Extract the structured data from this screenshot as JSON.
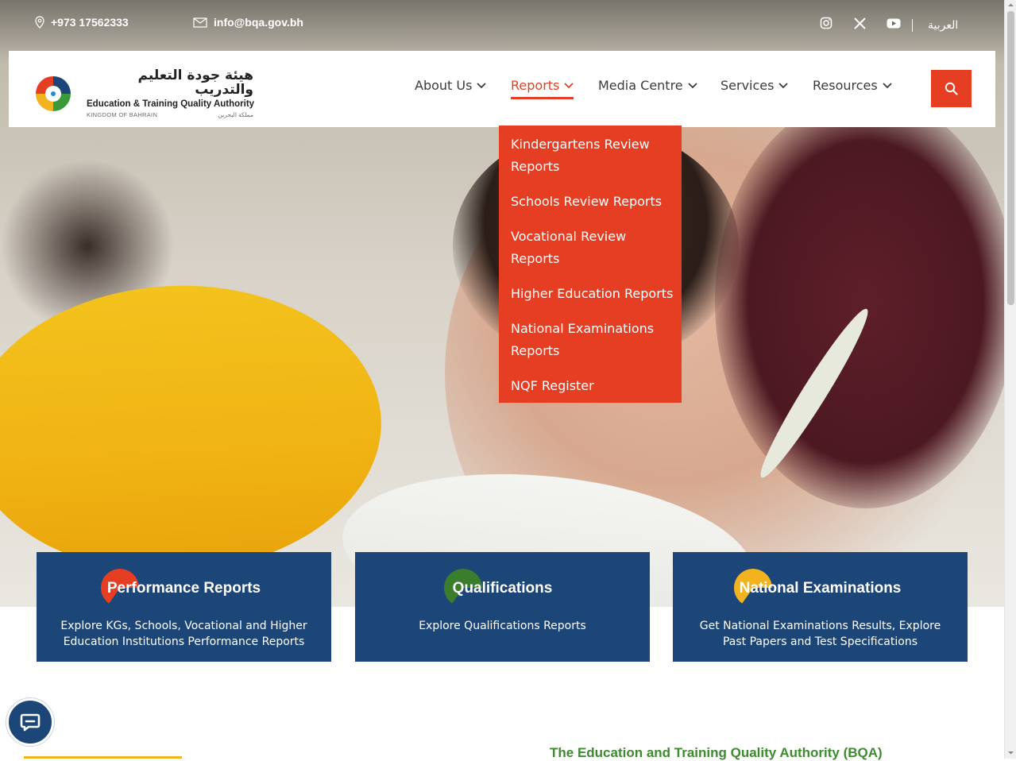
{
  "topbar": {
    "phone": "+973 17562333",
    "email": "info@bqa.gov.bh",
    "social": [
      "instagram-icon",
      "x-icon",
      "youtube-icon"
    ],
    "language": "العربية"
  },
  "logo": {
    "arabic": "هيئة جودة التعليم والتدريب",
    "english": "Education & Training Quality Authority",
    "sub_en": "KINGDOM OF BAHRAIN",
    "sub_ar": "مملكة البحرين"
  },
  "nav": {
    "items": [
      {
        "label": "About Us"
      },
      {
        "label": "Reports"
      },
      {
        "label": "Media Centre"
      },
      {
        "label": "Services"
      },
      {
        "label": "Resources"
      }
    ],
    "active": "Reports"
  },
  "dropdown": {
    "items": [
      "Kindergartens Review Reports",
      "Schools Review Reports",
      "Vocational Review Reports",
      "Higher Education Reports",
      "National Examinations Reports",
      "NQF Register"
    ]
  },
  "cards": [
    {
      "title": "Performance Reports",
      "desc": "Explore KGs, Schools, Vocational and Higher Education Institutions Performance Reports",
      "accent": "#e63e22"
    },
    {
      "title": "Qualifications",
      "desc": "Explore Qualifications Reports",
      "accent": "#3a7d2c"
    },
    {
      "title": "National Examinations",
      "desc": "Get National Examinations Results, Explore Past Papers and Test Specifications",
      "accent": "#f2b31e"
    }
  ],
  "section": {
    "heading": "The Education and Training Quality Authority (BQA)"
  },
  "colors": {
    "brand_red": "#e63e22",
    "brand_navy": "#1c4678",
    "brand_green": "#3d8b2e"
  }
}
